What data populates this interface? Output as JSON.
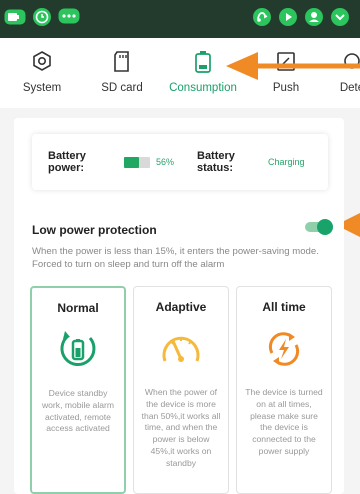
{
  "status_bar": {
    "left_icons": [
      "battery-toggle-icon",
      "clock-icon",
      "chat-icon"
    ],
    "right_icons": [
      "swipe-icon",
      "play-icon",
      "user-icon",
      "chevron-down-icon"
    ],
    "background": "#233b2c"
  },
  "tabs": [
    {
      "label": "System",
      "icon": "settings-hexagon-icon",
      "active": false
    },
    {
      "label": "SD card",
      "icon": "sd-card-icon",
      "active": false
    },
    {
      "label": "Consumption",
      "icon": "battery-icon",
      "active": true
    },
    {
      "label": "Push",
      "icon": "push-icon",
      "active": false
    },
    {
      "label": "Dete",
      "icon": "detection-icon",
      "active": false
    }
  ],
  "battery": {
    "power_label": "Battery power:",
    "power_value": "56%",
    "power_level": 0.56,
    "status_label": "Battery status:",
    "status_value": "Charging"
  },
  "low_power": {
    "title": "Low power protection",
    "enabled": true,
    "description": "When the power is less than 15%, it enters the power-saving mode. Forced to turn on sleep and turn off the alarm"
  },
  "modes": [
    {
      "title": "Normal",
      "icon": "battery-refresh-icon",
      "selected": true,
      "description": "Device standby work, mobile alarm activated, remote access activated"
    },
    {
      "title": "Adaptive",
      "icon": "gauge-icon",
      "selected": false,
      "description": "When the power of the device is more than 50%,it works all time, and when the power is below 45%,it works on standby"
    },
    {
      "title": "All time",
      "icon": "lightning-refresh-icon",
      "selected": false,
      "description": "The device is turned on at all times, please make sure the device is connected to the power supply"
    }
  ],
  "colors": {
    "accent": "#1aa06b",
    "annotation_arrow": "#f08a24"
  }
}
